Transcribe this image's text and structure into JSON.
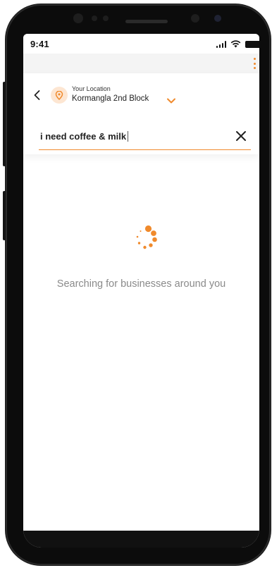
{
  "status_bar": {
    "time": "9:41"
  },
  "header": {
    "location_caption": "Your Location",
    "location_name": "Kormangla 2nd Block"
  },
  "search": {
    "value": "i need coffee & milk"
  },
  "loading": {
    "message": "Searching for businesses around you"
  },
  "icons": {
    "back": "chevron-left-icon",
    "location": "location-pin-icon",
    "location_dropdown": "chevron-down-icon",
    "clear": "close-icon",
    "menu": "kebab-menu-icon",
    "spinner": "loading-spinner-icon"
  },
  "colors": {
    "accent": "#f08a2c",
    "accent_light": "#fde6d2",
    "text_muted": "#8a8a8a",
    "app_bar": "#f4f4f4"
  }
}
